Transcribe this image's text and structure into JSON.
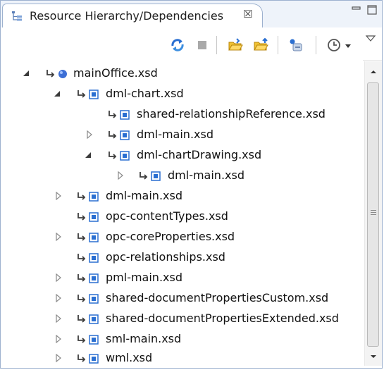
{
  "tab": {
    "title": "Resource Hierarchy/Dependencies",
    "close_glyph": "☒"
  },
  "tree": {
    "items": [
      {
        "label": "mainOffice.xsd",
        "expanded": true,
        "type": "root"
      },
      {
        "label": "dml-chart.xsd",
        "expanded": true
      },
      {
        "label": "shared-relationshipReference.xsd"
      },
      {
        "label": "dml-main.xsd",
        "expanded": false
      },
      {
        "label": "dml-chartDrawing.xsd",
        "expanded": true
      },
      {
        "label": "dml-main.xsd",
        "expanded": false
      },
      {
        "label": "dml-main.xsd",
        "expanded": false
      },
      {
        "label": "opc-contentTypes.xsd"
      },
      {
        "label": "opc-coreProperties.xsd",
        "expanded": false
      },
      {
        "label": "opc-relationships.xsd"
      },
      {
        "label": "pml-main.xsd",
        "expanded": false
      },
      {
        "label": "shared-documentPropertiesCustom.xsd",
        "expanded": false
      },
      {
        "label": "shared-documentPropertiesExtended.xsd",
        "expanded": false
      },
      {
        "label": "sml-main.xsd",
        "expanded": false
      },
      {
        "label": "wml.xsd",
        "expanded": false
      }
    ]
  },
  "colors": {
    "accent_blue": "#2a6fd1",
    "folder_yellow": "#f1c232",
    "border": "#9db1cf"
  },
  "icons": {
    "tab": "hierarchy-icon",
    "toolbar": [
      "refresh-icon",
      "stop-icon",
      "open-folder-icon",
      "open-folder-up-icon",
      "settings-icon",
      "history-icon",
      "dropdown-arrow-icon",
      "view-menu-icon"
    ]
  }
}
